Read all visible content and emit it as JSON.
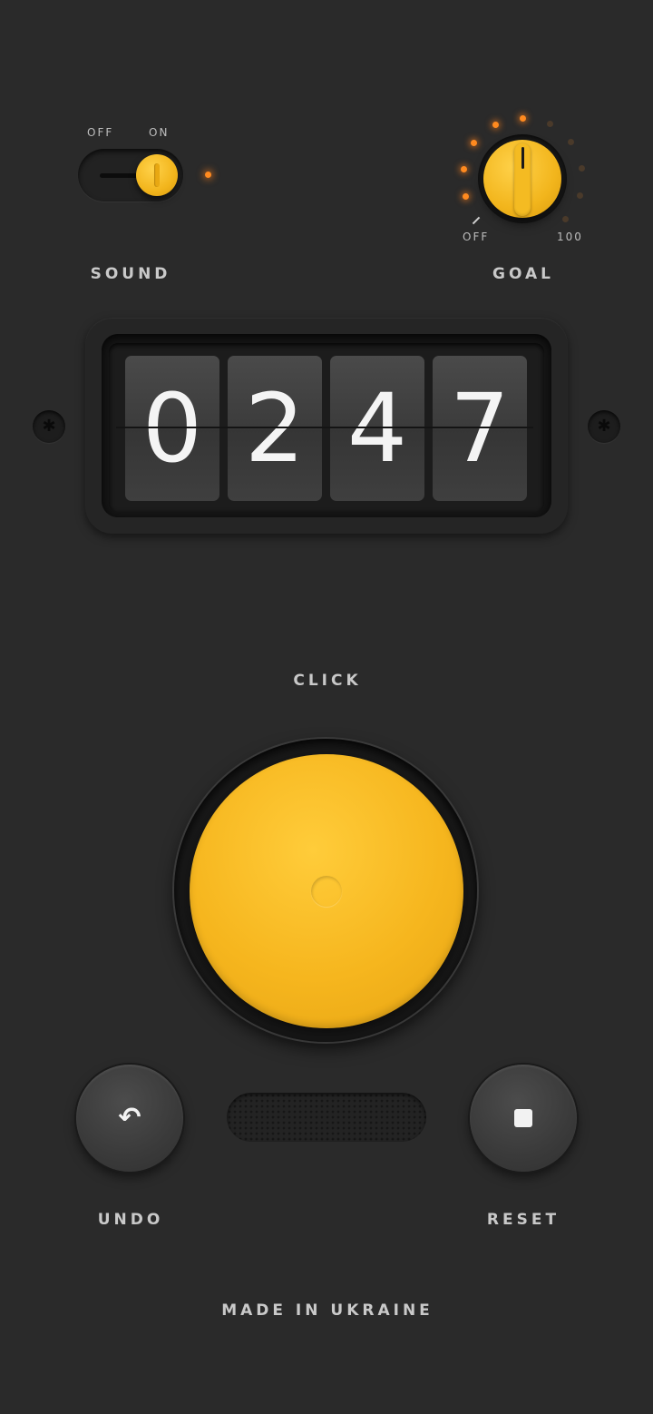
{
  "sound": {
    "off_label": "OFF",
    "on_label": "ON",
    "title": "SOUND",
    "state": "on"
  },
  "goal": {
    "off_label": "OFF",
    "max_label": "100",
    "title": "GOAL",
    "lit_segments": 6,
    "total_segments": 10
  },
  "counter": {
    "digits": [
      "0",
      "2",
      "4",
      "7"
    ]
  },
  "click": {
    "label": "CLICK"
  },
  "controls": {
    "undo_label": "UNDO",
    "reset_label": "RESET"
  },
  "footer": {
    "text": "MADE IN UKRAINE"
  },
  "colors": {
    "background": "#2a2a2a",
    "accent_yellow": "#f6b61e",
    "led_orange": "#ff8a1f",
    "text": "#c9c9c9"
  },
  "icons": {
    "undo": "undo-arrow-icon",
    "reset": "stop-square-icon"
  }
}
